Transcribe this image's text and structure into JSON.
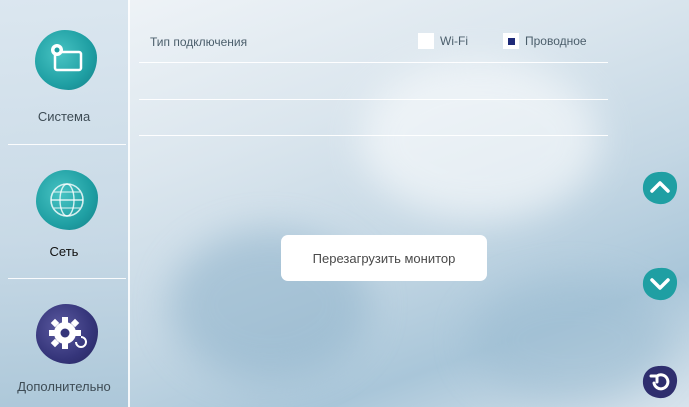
{
  "sidebar": {
    "items": [
      {
        "label": "Система",
        "icon": "system-settings-icon"
      },
      {
        "label": "Сеть",
        "icon": "network-globe-icon"
      },
      {
        "label": "Дополнительно",
        "icon": "advanced-gear-icon"
      }
    ]
  },
  "network": {
    "connection_type_label": "Тип подключения",
    "options": [
      {
        "label": "Wi-Fi",
        "checked": false
      },
      {
        "label": "Проводное",
        "checked": true
      }
    ]
  },
  "reboot_button": {
    "label": "Перезагрузить монитор"
  },
  "controls": {
    "scroll_up": "chevron-up-icon",
    "scroll_down": "chevron-down-icon",
    "back": "return-arrow-icon"
  },
  "colors": {
    "accent_teal": "#1f9fa3",
    "accent_dark": "#2e2e6e",
    "checkbox_fill": "#1e2a78"
  }
}
